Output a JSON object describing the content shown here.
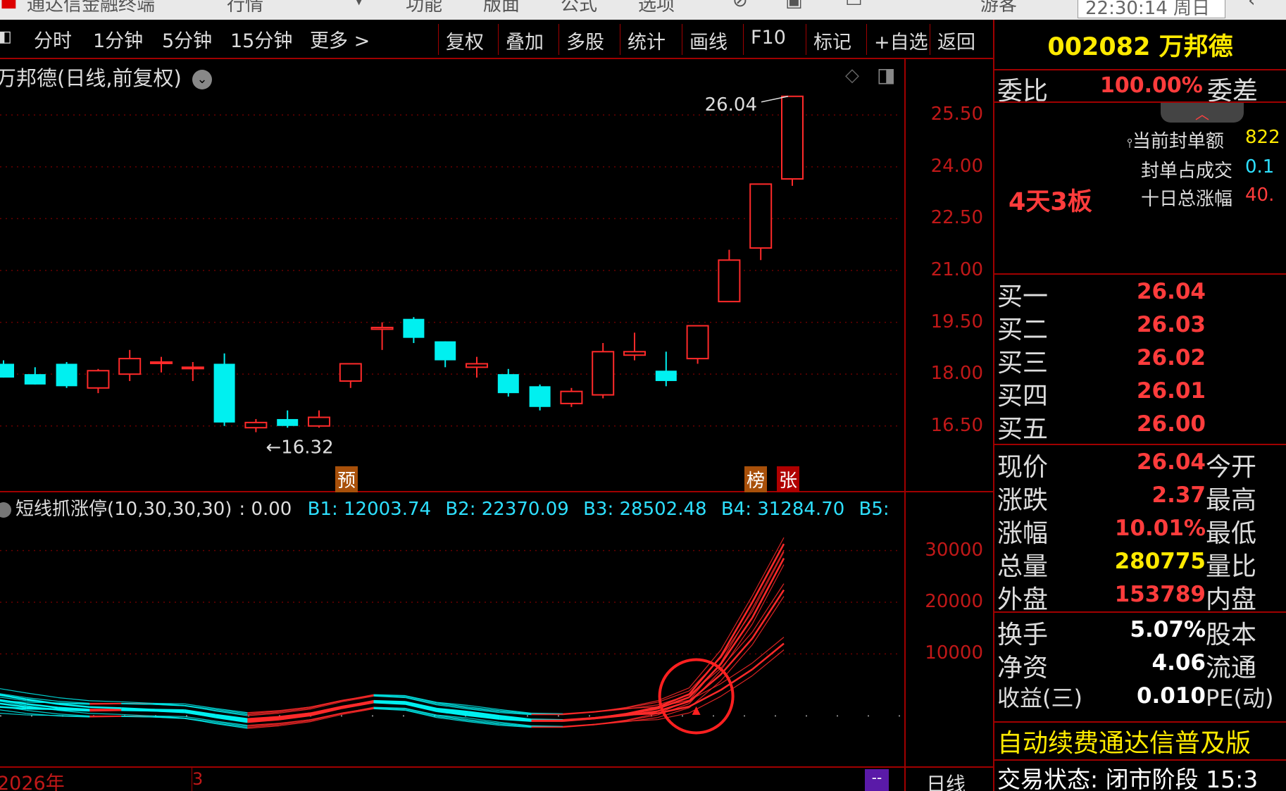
{
  "topbar": {
    "items": [
      "通达信金融终端",
      "行情",
      "功能",
      "版面",
      "公式",
      "选项",
      "游客"
    ],
    "time": "22:30:14 周日"
  },
  "toolbar": {
    "periods": [
      "分时",
      "1分钟",
      "5分钟",
      "15分钟",
      "更多 >"
    ],
    "buttons": [
      "复权",
      "叠加",
      "多股",
      "统计",
      "画线",
      "F10",
      "标记",
      "+自选",
      "返回"
    ]
  },
  "main_chart": {
    "title": "万邦德(日线,前复权)",
    "high_label": "26.04",
    "low_label": "16.32",
    "marks": {
      "yu": "预",
      "bang": "榜",
      "zhang": "张"
    }
  },
  "indicator": {
    "title": "短线抓涨停(10,30,30,30)",
    "value": ": 0.00",
    "b1": "B1: 12003.74",
    "b2": "B2: 22370.09",
    "b3": "B3: 28502.48",
    "b4": "B4: 31284.70",
    "b5": "B5:"
  },
  "bottom": {
    "year": "2026年",
    "month": "3",
    "dash": "--",
    "period": "日线"
  },
  "colors": {
    "up": "#ff2a2a",
    "down": "#00f0f0",
    "axis": "#c01818",
    "bg": "#000000",
    "yellow": "#ffea00"
  },
  "chart_data": [
    {
      "type": "candlestick",
      "ylim": [
        15.7,
        26.3
      ],
      "yticks": [
        25.5,
        24.0,
        22.5,
        21.0,
        19.5,
        18.0,
        16.5
      ],
      "candles": [
        {
          "o": 18.3,
          "h": 18.4,
          "l": 17.9,
          "c": 17.9
        },
        {
          "o": 18.0,
          "h": 18.2,
          "l": 17.7,
          "c": 17.7
        },
        {
          "o": 18.3,
          "h": 18.35,
          "l": 17.6,
          "c": 17.65
        },
        {
          "o": 17.6,
          "h": 18.15,
          "l": 17.45,
          "c": 18.1
        },
        {
          "o": 18.0,
          "h": 18.7,
          "l": 17.8,
          "c": 18.45
        },
        {
          "o": 18.35,
          "h": 18.5,
          "l": 18.05,
          "c": 18.35
        },
        {
          "o": 18.2,
          "h": 18.35,
          "l": 17.8,
          "c": 18.2
        },
        {
          "o": 18.3,
          "h": 18.6,
          "l": 16.5,
          "c": 16.6
        },
        {
          "o": 16.45,
          "h": 16.7,
          "l": 16.32,
          "c": 16.6
        },
        {
          "o": 16.7,
          "h": 16.95,
          "l": 16.45,
          "c": 16.5
        },
        {
          "o": 16.5,
          "h": 16.95,
          "l": 16.45,
          "c": 16.75
        },
        {
          "o": 17.8,
          "h": 18.3,
          "l": 17.6,
          "c": 18.3
        },
        {
          "o": 19.3,
          "h": 19.5,
          "l": 18.7,
          "c": 19.35
        },
        {
          "o": 19.6,
          "h": 19.65,
          "l": 18.9,
          "c": 19.05
        },
        {
          "o": 18.95,
          "h": 18.95,
          "l": 18.2,
          "c": 18.4
        },
        {
          "o": 18.2,
          "h": 18.5,
          "l": 17.9,
          "c": 18.3
        },
        {
          "o": 18.0,
          "h": 18.15,
          "l": 17.35,
          "c": 17.45
        },
        {
          "o": 17.65,
          "h": 17.7,
          "l": 16.95,
          "c": 17.05
        },
        {
          "o": 17.15,
          "h": 17.6,
          "l": 17.05,
          "c": 17.5
        },
        {
          "o": 17.4,
          "h": 18.9,
          "l": 17.3,
          "c": 18.65
        },
        {
          "o": 18.55,
          "h": 19.2,
          "l": 18.4,
          "c": 18.65
        },
        {
          "o": 18.1,
          "h": 18.65,
          "l": 17.65,
          "c": 17.8
        },
        {
          "o": 18.45,
          "h": 19.4,
          "l": 18.3,
          "c": 19.4
        },
        {
          "o": 20.1,
          "h": 21.6,
          "l": 20.1,
          "c": 21.3
        },
        {
          "o": 21.65,
          "h": 23.5,
          "l": 21.3,
          "c": 23.5
        },
        {
          "o": 23.65,
          "h": 26.04,
          "l": 23.45,
          "c": 26.04
        }
      ]
    },
    {
      "type": "line",
      "title": "短线抓涨停(10,30,30,30)",
      "ylim": [
        -10000,
        35000
      ],
      "yticks": [
        30000,
        20000,
        10000
      ],
      "x": [
        1,
        2,
        3,
        4,
        5,
        6,
        7,
        8,
        9,
        10,
        11,
        12,
        13,
        14,
        15,
        16,
        17,
        18,
        19,
        20,
        21,
        22,
        23,
        24,
        25,
        26
      ],
      "series": [
        {
          "name": "B1",
          "values": [
            -200,
            -600,
            -700,
            -900,
            -800,
            -800,
            -900,
            -1800,
            -2600,
            -2200,
            -1500,
            -300,
            900,
            700,
            -600,
            -1200,
            -2000,
            -2700,
            -2800,
            -2400,
            -1800,
            -1500,
            -200,
            3000,
            7000,
            12003.74
          ]
        },
        {
          "name": "B2",
          "values": [
            500,
            -300,
            -800,
            -1000,
            -900,
            -1000,
            -1200,
            -2000,
            -2800,
            -2300,
            -1500,
            -200,
            800,
            600,
            -700,
            -1500,
            -2200,
            -2800,
            -2900,
            -2500,
            -1900,
            -1100,
            800,
            6000,
            13000,
            22370.09
          ]
        },
        {
          "name": "B3",
          "values": [
            1200,
            300,
            -400,
            -800,
            -800,
            -1000,
            -1300,
            -2200,
            -3000,
            -2500,
            -1700,
            -300,
            700,
            400,
            -900,
            -1700,
            -2400,
            -2900,
            -2900,
            -2400,
            -1700,
            -600,
            1600,
            8000,
            17000,
            28502.48
          ]
        },
        {
          "name": "B4",
          "values": [
            2200,
            1200,
            300,
            -300,
            -500,
            -800,
            -1200,
            -2300,
            -3200,
            -2700,
            -1900,
            -500,
            600,
            300,
            -1100,
            -1900,
            -2600,
            -3000,
            -3000,
            -2500,
            -1600,
            -300,
            2200,
            9500,
            20000,
            31284.7
          ]
        }
      ]
    }
  ],
  "right_panel": {
    "code_name": "002082 万邦德",
    "wei_bi_label": "委比",
    "wei_bi": "100.00%",
    "wei_cha_label": "委差",
    "current_seal_label": "当前封单额",
    "current_seal": "822",
    "seal_ratio_label": "封单占成交",
    "seal_ratio": "0.1",
    "ten_day_label": "十日总涨幅",
    "ten_day": "40.",
    "streak": "4天3板",
    "bids": [
      {
        "label": "买一",
        "price": "26.04"
      },
      {
        "label": "买二",
        "price": "26.03"
      },
      {
        "label": "买三",
        "price": "26.02"
      },
      {
        "label": "买四",
        "price": "26.01"
      },
      {
        "label": "买五",
        "price": "26.00"
      }
    ],
    "stats1": [
      {
        "label": "现价",
        "value": "26.04",
        "label2": "今开",
        "color": "#ff3c3c"
      },
      {
        "label": "涨跌",
        "value": "2.37",
        "label2": "最高",
        "color": "#ff3c3c"
      },
      {
        "label": "涨幅",
        "value": "10.01%",
        "label2": "最低",
        "color": "#ff3c3c"
      },
      {
        "label": "总量",
        "value": "280775",
        "label2": "量比",
        "color": "#ffea00"
      },
      {
        "label": "外盘",
        "value": "153789",
        "label2": "内盘",
        "color": "#ff3c3c"
      }
    ],
    "stats2": [
      {
        "label": "换手",
        "value": "5.07%",
        "label2": "股本"
      },
      {
        "label": "净资",
        "value": "4.06",
        "label2": "流通"
      },
      {
        "label": "收益(三)",
        "value": "0.010",
        "label2": "PE(动)"
      }
    ],
    "promo": "自动续费通达信普及版",
    "status": "交易状态: 闭市阶段 15:3"
  }
}
